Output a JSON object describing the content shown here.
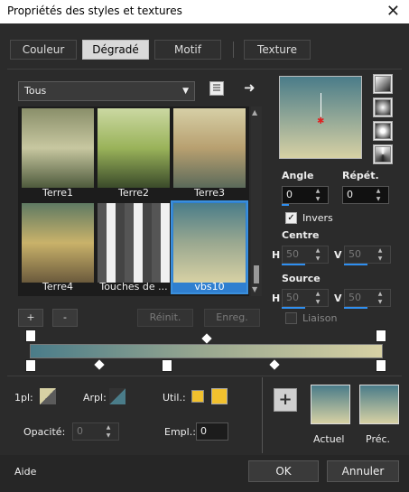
{
  "window": {
    "title": "Propriétés des styles et textures",
    "close_glyph": "✕"
  },
  "tabs": [
    "Couleur",
    "Dégradé",
    "Motif",
    "Texture"
  ],
  "dropdown": {
    "value": "Tous"
  },
  "gradients": [
    {
      "label": "Terre1",
      "c1": "#8a8f6a",
      "c2": "#c7c7a0",
      "c3": "#4e5a3c"
    },
    {
      "label": "Terre2",
      "c1": "#cbd8a2",
      "c2": "#9ab35a",
      "c3": "#3a4a2a"
    },
    {
      "label": "Terre3",
      "c1": "#d6cfa6",
      "c2": "#b8a070",
      "c3": "#5b6a5a"
    },
    {
      "label": "Terre4",
      "c1": "#5f7a63",
      "c2": "#c9b26a",
      "c3": "#6b5a3c"
    },
    {
      "label": "Touches de ...",
      "c1": "#555555",
      "c2": "#f0f0f0",
      "c3": "#444444"
    },
    {
      "label": "vbs10",
      "c1": "#4a7c89",
      "c2": "#9aa890",
      "c3": "#d7d1a4"
    }
  ],
  "buttons": {
    "plus": "+",
    "minus": "-",
    "reinit": "Réinit.",
    "enreg": "Enreg."
  },
  "angle": {
    "label": "Angle",
    "value": "0"
  },
  "repet": {
    "label": "Répét.",
    "value": "0"
  },
  "invers": {
    "label": "Invers"
  },
  "centre": {
    "label": "Centre",
    "h_label": "H",
    "h_value": "50",
    "v_label": "V",
    "v_value": "50"
  },
  "source": {
    "label": "Source",
    "h_label": "H",
    "h_value": "50",
    "v_label": "V",
    "v_value": "50"
  },
  "liaison": {
    "label": "Liaison"
  },
  "bottom": {
    "labels": {
      "pl": "1pl:",
      "arpl": "Arpl:",
      "util": "Util.:",
      "opacite": "Opacité:",
      "empl": "Empl.:"
    },
    "opacite_value": "0",
    "empl_value": "0"
  },
  "preview": {
    "actuel": "Actuel",
    "prec": "Préc.",
    "add_glyph": "+"
  },
  "footer": {
    "aide": "Aide",
    "ok": "OK",
    "annuler": "Annuler"
  },
  "colors": {
    "accent": "#2f7fd0",
    "gradient_start": "#4a7c89",
    "gradient_end": "#d7d1a4",
    "util_yellow": "#f2c12e"
  }
}
